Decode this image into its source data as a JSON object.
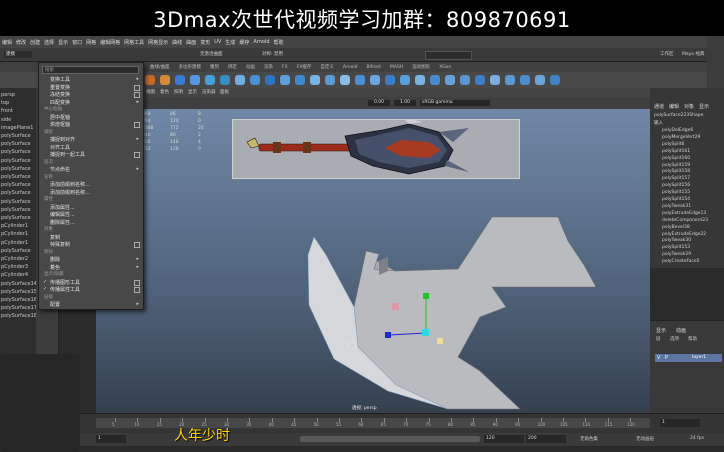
{
  "banner": {
    "text": "3Dmax次世代视频学习加群：809870691"
  },
  "menu_bar": {
    "items": [
      "编辑",
      "修改",
      "创建",
      "选择",
      "显示",
      "窗口",
      "网格",
      "编辑网格",
      "网格工具",
      "网格显示",
      "曲线",
      "曲面",
      "变形",
      "UV",
      "生成",
      "缓存",
      "Arnold",
      "帮助"
    ]
  },
  "shelf_tabs": [
    "曲线/曲面",
    "多边形建模",
    "雕刻",
    "绑定",
    "动画",
    "渲染",
    "FX",
    "FX缓存",
    "自定义",
    "Arnold",
    "Bifrost",
    "MASH",
    "运动图形",
    "XGen"
  ],
  "dropdown": {
    "search_placeholder": "搜索",
    "items": [
      {
        "label": "变换工具",
        "type": "item",
        "arrow": true
      },
      {
        "label": "重置变换",
        "type": "item",
        "box": true
      },
      {
        "label": "冻结变换",
        "type": "item",
        "box": true
      },
      {
        "label": "匹配变换",
        "type": "item",
        "arrow": true
      },
      {
        "label": "中心枢轴",
        "type": "section"
      },
      {
        "label": "居中枢轴",
        "type": "item"
      },
      {
        "label": "烘焙枢轴",
        "type": "item",
        "box": true
      },
      {
        "label": "捕捉",
        "type": "section"
      },
      {
        "label": "捕捉到对齐",
        "type": "item",
        "arrow": true
      },
      {
        "label": "对齐工具",
        "type": "item"
      },
      {
        "label": "捕捉到一起工具",
        "type": "item",
        "box": true
      },
      {
        "label": "层次",
        "type": "section"
      },
      {
        "label": "节点命名",
        "type": "item",
        "arrow": true
      },
      {
        "label": "名称",
        "type": "section"
      },
      {
        "label": "添加前缀到名称...",
        "type": "item"
      },
      {
        "label": "添加前缀到名称...",
        "type": "item"
      },
      {
        "label": "属性",
        "type": "section"
      },
      {
        "label": "添加属性...",
        "type": "item"
      },
      {
        "label": "编辑属性...",
        "type": "item"
      },
      {
        "label": "删除属性...",
        "type": "item"
      },
      {
        "label": "对象",
        "type": "section"
      },
      {
        "label": "复制",
        "type": "item"
      },
      {
        "label": "特殊复制",
        "type": "item",
        "box": true
      },
      {
        "label": "移除",
        "type": "section"
      },
      {
        "label": "删除",
        "type": "item",
        "arrow": true
      },
      {
        "label": "着色",
        "type": "item",
        "arrow": true
      },
      {
        "label": "显示/隐藏",
        "type": "section"
      },
      {
        "label": "传播图形工具",
        "type": "item",
        "box": true,
        "check": true
      },
      {
        "label": "传播属性工具",
        "type": "item",
        "box": true,
        "check": true
      },
      {
        "label": "层级",
        "type": "section"
      },
      {
        "label": "配置",
        "type": "item",
        "arrow": true
      }
    ]
  },
  "outliner": {
    "items": [
      "persp",
      "top",
      "front",
      "side",
      "imagePlane1",
      "polySurface",
      "polySurface",
      "polySurface",
      "polySurface",
      "polySurface",
      "polySurface",
      "polySurface",
      "polySurface",
      "polySurface",
      "polySurface",
      "polySurface",
      "pCylinder1",
      "pCylinder1",
      "pCylinder1",
      "polySurface",
      "pCylinder2",
      "pCylinder3",
      "pCylinder4",
      "polySurface14",
      "polySurface15",
      "polySurface16",
      "polySurface17",
      "polySurface18"
    ]
  },
  "data_table": {
    "rows": [
      [
        "888",
        "86",
        "8"
      ],
      [
        "264",
        "120",
        "0"
      ],
      [
        "2388",
        "772",
        "20"
      ],
      [
        "240",
        "80",
        "2"
      ],
      [
        "456",
        "148",
        "4"
      ],
      [
        "232",
        "120",
        "0"
      ]
    ]
  },
  "viewport": {
    "camera_label": "透视: persp",
    "toolbar_value_1": "0.00",
    "toolbar_value_2": "1.00",
    "colorspace": "sRGB gamma"
  },
  "channel_box": {
    "tabs": [
      "通道",
      "编辑",
      "对象",
      "显示"
    ],
    "object": "polySurface223Shape",
    "input_label": "输入",
    "history": [
      "polyDelEdge6",
      "polyMergeVert29",
      "polySplit6",
      "polySplit161",
      "polySplit160",
      "polySplit159",
      "polySplit158",
      "polySplit157",
      "polySplit156",
      "polySplit155",
      "polySplit154",
      "polyTweak31",
      "polyExtrudeEdge13",
      "deleteComponent23",
      "polyBevel38",
      "polyExtrudeEdge22",
      "polyTweak30",
      "polySplit153",
      "polyTweak29",
      "polyCreateFace5"
    ]
  },
  "layer_editor": {
    "tabs": [
      "显示",
      "动画"
    ],
    "menu": [
      "层",
      "选项",
      "帮助"
    ],
    "layer_name": "layer1"
  },
  "timeline": {
    "ticks": [
      "5",
      "10",
      "15",
      "20",
      "25",
      "30",
      "35",
      "40",
      "45",
      "50",
      "55",
      "60",
      "65",
      "70",
      "75",
      "80",
      "85",
      "90",
      "95",
      "100",
      "105",
      "110",
      "115",
      "120"
    ],
    "current_frame": "1",
    "range_start": "1",
    "range_playback": "120",
    "range_end": "120",
    "range_end_total": "200",
    "anim_layer": "无角色集",
    "anim_layer2": "无动画层",
    "fps": "24 fps"
  },
  "subtitle": "人年少时",
  "top_right": {
    "workspace_label": "工作区",
    "workspace_value": "Maya 经典"
  },
  "status_line": {
    "mode": "建模",
    "no_live": "无激活曲面",
    "symmetry": "对称: 禁用"
  }
}
